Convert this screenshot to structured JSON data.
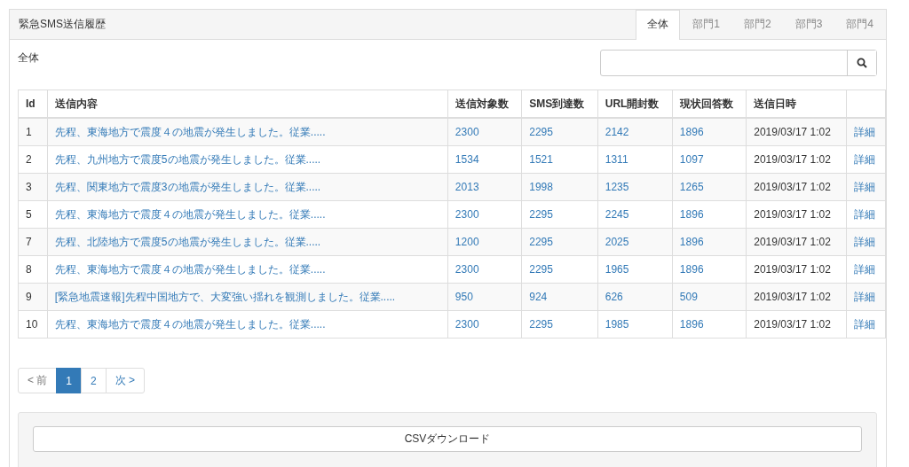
{
  "panel": {
    "title": "緊急SMS送信履歴"
  },
  "tabs": [
    {
      "label": "全体",
      "selected": true
    },
    {
      "label": "部門1",
      "selected": false
    },
    {
      "label": "部門2",
      "selected": false
    },
    {
      "label": "部門3",
      "selected": false
    },
    {
      "label": "部門4",
      "selected": false
    }
  ],
  "section_label": "全体",
  "table": {
    "columns": [
      "Id",
      "送信内容",
      "送信対象数",
      "SMS到達数",
      "URL開封数",
      "現状回答数",
      "送信日時"
    ],
    "rows": [
      {
        "id": "1",
        "content": "先程、東海地方で震度４の地震が発生しました。従業.....",
        "targets": "2300",
        "delivered": "2295",
        "opened": "2142",
        "answered": "1896",
        "sent_at": "2019/03/17 1:02",
        "detail": "詳細"
      },
      {
        "id": "2",
        "content": "先程、九州地方で震度5の地震が発生しました。従業.....",
        "targets": "1534",
        "delivered": "1521",
        "opened": "1311",
        "answered": "1097",
        "sent_at": "2019/03/17 1:02",
        "detail": "詳細"
      },
      {
        "id": "3",
        "content": "先程、関東地方で震度3の地震が発生しました。従業.....",
        "targets": "2013",
        "delivered": "1998",
        "opened": "1235",
        "answered": "1265",
        "sent_at": "2019/03/17 1:02",
        "detail": "詳細"
      },
      {
        "id": "5",
        "content": "先程、東海地方で震度４の地震が発生しました。従業.....",
        "targets": "2300",
        "delivered": "2295",
        "opened": "2245",
        "answered": "1896",
        "sent_at": "2019/03/17 1:02",
        "detail": "詳細"
      },
      {
        "id": "7",
        "content": "先程、北陸地方で震度5の地震が発生しました。従業.....",
        "targets": "1200",
        "delivered": "2295",
        "opened": "2025",
        "answered": "1896",
        "sent_at": "2019/03/17 1:02",
        "detail": "詳細"
      },
      {
        "id": "8",
        "content": "先程、東海地方で震度４の地震が発生しました。従業.....",
        "targets": "2300",
        "delivered": "2295",
        "opened": "1965",
        "answered": "1896",
        "sent_at": "2019/03/17 1:02",
        "detail": "詳細"
      },
      {
        "id": "9",
        "content": "[緊急地震速報]先程中国地方で、大変強い揺れを観測しました。従業.....",
        "targets": "950",
        "delivered": "924",
        "opened": "626",
        "answered": "509",
        "sent_at": "2019/03/17 1:02",
        "detail": "詳細"
      },
      {
        "id": "10",
        "content": "先程、東海地方で震度４の地震が発生しました。従業.....",
        "targets": "2300",
        "delivered": "2295",
        "opened": "1985",
        "answered": "1896",
        "sent_at": "2019/03/17 1:02",
        "detail": "詳細"
      }
    ]
  },
  "pagination": [
    {
      "label": "< 前",
      "selected": false,
      "disabled": true
    },
    {
      "label": "1",
      "selected": true,
      "disabled": false
    },
    {
      "label": "2",
      "selected": false,
      "disabled": false
    },
    {
      "label": "次 >",
      "selected": false,
      "disabled": false
    }
  ],
  "csv_button": "CSVダウンロード"
}
